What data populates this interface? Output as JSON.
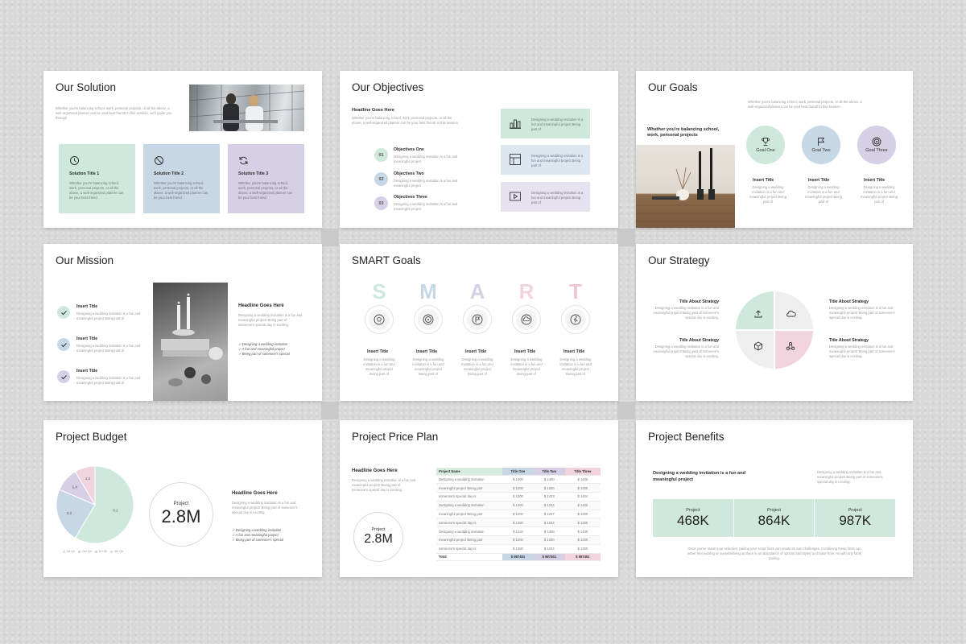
{
  "solution": {
    "title": "Our Solution",
    "intro": "Whether you're balancing school, work, personal projects, or all the above, a well-organized planner can be your best friend! In this session, we'll guide you through",
    "cards": [
      {
        "title": "Solution Title 1",
        "desc": "Whether you're balancing school, work, personal projects, or all the above, a well-organized planner can be your best friend",
        "color": "#cfe8dc",
        "icon": "clock-icon"
      },
      {
        "title": "Solution Title 2",
        "desc": "Whether you're balancing school, work, personal projects, or all the above, a well-organized planner can be your best friend",
        "color": "#c7d7e6",
        "icon": "no-entry-icon"
      },
      {
        "title": "Solution Title 3",
        "desc": "Whether you're balancing school, work, personal projects, or all the above, a well-organized planner can be your best friend",
        "color": "#d7cfe6",
        "icon": "refresh-icon"
      }
    ]
  },
  "objectives": {
    "title": "Our Objectives",
    "headline": "Headline Goes Here",
    "intro": "Whether you're balancing school, work, personal projects, or all the above, a well-organized planner can be your best friend! In this session.",
    "items": [
      {
        "num": "01",
        "title": "Objectives One",
        "desc": "Designing a wedding invitation is a fun and meaningful project"
      },
      {
        "num": "02",
        "title": "Objectives Two",
        "desc": "Designing a wedding invitation is a fun and meaningful project"
      },
      {
        "num": "03",
        "title": "Objectives Three",
        "desc": "Designing a wedding invitation is a fun and meaningful project"
      }
    ],
    "boxes": [
      {
        "desc": "Designing a wedding invitation is a fun and meaningful project Being part of",
        "icon": "bar-chart-icon"
      },
      {
        "desc": "Designing a wedding invitation is a fun and meaningful project Being part of",
        "icon": "layout-icon"
      },
      {
        "desc": "Designing a wedding invitation is a fun and meaningful project Being part of",
        "icon": "video-icon"
      }
    ]
  },
  "goals": {
    "title": "Our Goals",
    "intro": "Whether you're balancing school, work, personal projects, or all the above, a well-organized planner can be your best friend! In this session.",
    "photo_caption": "Whether you're balancing school, work, personal projects",
    "items": [
      {
        "label": "Goal One",
        "title": "Insert Title",
        "desc": "Designing a wedding invitation is a fun and meaningful project Being part of",
        "icon": "trophy-icon"
      },
      {
        "label": "Goal Two",
        "title": "Insert Title",
        "desc": "Designing a wedding invitation is a fun and meaningful project Being part of",
        "icon": "flag-icon"
      },
      {
        "label": "Goal Three",
        "title": "Insert Title",
        "desc": "Designing a wedding invitation is a fun and meaningful project Being part of",
        "icon": "target-icon"
      }
    ]
  },
  "mission": {
    "title": "Our Mission",
    "items": [
      {
        "title": "Insert Title",
        "desc": "Designing a wedding invitation is a fun and meaningful project Being part of"
      },
      {
        "title": "Insert Title",
        "desc": "Designing a wedding invitation is a fun and meaningful project Being part of"
      },
      {
        "title": "Insert Title",
        "desc": "Designing a wedding invitation is a fun and meaningful project Being part of"
      }
    ],
    "headline": "Headline Goes Here",
    "body": "Designing a wedding invitation is a fun and meaningful project! Being part of someone's special day is exciting.",
    "bullets": [
      "Designing a wedding invitation",
      "A fun and meaningful project",
      "Being part of someone's special"
    ]
  },
  "smart": {
    "title": "SMART Goals",
    "letters": [
      {
        "char": "S",
        "color": "#cfe8dc",
        "icon": "soccer-icon"
      },
      {
        "char": "M",
        "color": "#c7d7e6",
        "icon": "target-icon"
      },
      {
        "char": "A",
        "color": "#d7cfe6",
        "icon": "flag-icon"
      },
      {
        "char": "R",
        "color": "#f2d4de",
        "icon": "cloud-icon"
      },
      {
        "char": "T",
        "color": "#f2c4d4",
        "icon": "runner-icon"
      }
    ],
    "item_title": "Insert Title",
    "item_desc": "Designing a wedding invitation is a fun and meaningful project Being part of"
  },
  "strategy": {
    "title": "Our Strategy",
    "blocks": [
      {
        "title": "Title About Strategy",
        "desc": "Designing a wedding invitation is a fun and meaningful project! Being part of someone's special day is exciting."
      },
      {
        "title": "Title About Strategy",
        "desc": "Designing a wedding invitation is a fun and meaningful project! Being part of someone's special day is exciting."
      },
      {
        "title": "Title About Strategy",
        "desc": "Designing a wedding invitation is a fun and meaningful project! Being part of someone's special day is exciting."
      },
      {
        "title": "Title About Strategy",
        "desc": "Designing a wedding invitation is a fun and meaningful project! Being part of someone's special day is exciting."
      }
    ]
  },
  "budget": {
    "title": "Project Budget",
    "circle_label": "Project",
    "circle_value": "2.8M",
    "headline": "Headline Goes Here",
    "body": "Designing a wedding invitation is a fun and meaningful project! Being part of someone's special day is exciting.",
    "bullets": [
      "Designing a wedding invitation",
      "A fun and meaningful project",
      "Being part of someone's special"
    ]
  },
  "chart_data": {
    "type": "pie",
    "categories": [
      "1st Qtr",
      "2nd Qtr",
      "3rd Qtr",
      "4th Qtr"
    ],
    "values": [
      8.2,
      3.2,
      1.4,
      1.2
    ],
    "colors": [
      "#cfe8dc",
      "#c7d7e6",
      "#d7cfe6",
      "#f2d4de"
    ],
    "legend_position": "bottom"
  },
  "price_plan": {
    "title": "Project Price Plan",
    "headline": "Headline Goes Here",
    "body": "Designing a wedding invitation is a fun and meaningful project! Being part of someone's special day is exciting.",
    "circle_label": "Project",
    "circle_value": "2.8M",
    "columns": [
      "Project Name",
      "Title One",
      "Title Two",
      "Title Three"
    ],
    "rows": [
      [
        "Designing a wedding invitation",
        "$ 1400",
        "$ 1400",
        "$ 1400"
      ],
      [
        "meaningful project Being part",
        "$ 1200",
        "$ 1200",
        "$ 1200"
      ],
      [
        "someone's special day is",
        "$ 1300",
        "$ 1423",
        "$ 1424"
      ],
      [
        "Designing a wedding invitation",
        "$ 1400",
        "$ 1234",
        "$ 1400"
      ],
      [
        "meaningful project Being part",
        "$ 1200",
        "$ 1267",
        "$ 1200"
      ],
      [
        "someone's special day is",
        "$ 1300",
        "$ 1234",
        "$ 1300"
      ],
      [
        "Designing a wedding invitation",
        "$ 1234",
        "$ 1400",
        "$ 1400"
      ],
      [
        "meaningful project Being part",
        "$ 1200",
        "$ 1200",
        "$ 1200"
      ],
      [
        "someone's special day is",
        "$ 1300",
        "$ 1234",
        "$ 1300"
      ]
    ],
    "total": [
      "Total",
      "$ 987451",
      "$ 987451",
      "$ 987451"
    ]
  },
  "benefits": {
    "title": "Project Benefits",
    "lead": "Designing a wedding invitation is a fun and meaningful project",
    "side": "Designing a wedding invitation is a fun and meaningful project! Being part of someone's special day is exciting.",
    "stats": [
      {
        "label": "Project",
        "value": "468K"
      },
      {
        "label": "Project",
        "value": "864K"
      },
      {
        "label": "Project",
        "value": "987K"
      }
    ],
    "footer": "Once you've made your selection, pairing your script fonts can create its own challenges. Combining these fonts can either feel exciting or overwhelming as there is an abundance of options and styles to choose from. As with any fonts pairing."
  }
}
